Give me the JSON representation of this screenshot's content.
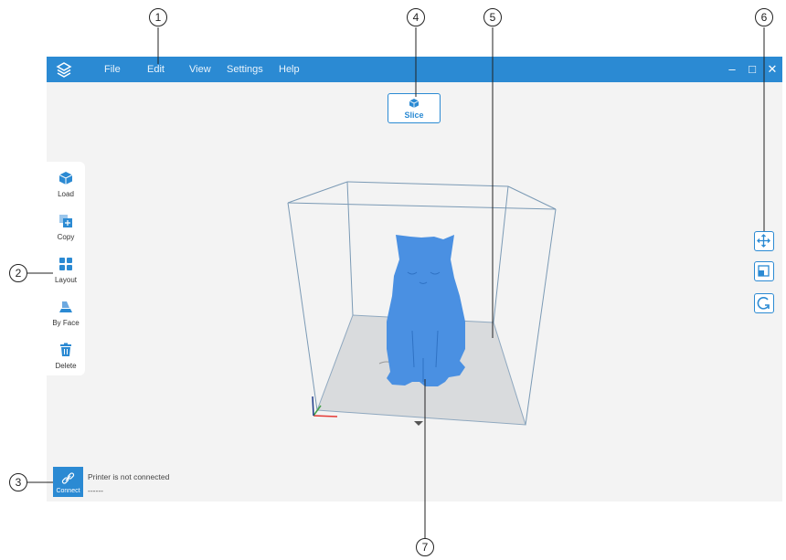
{
  "menu": {
    "file": "File",
    "edit": "Edit",
    "view": "View",
    "settings": "Settings",
    "help": "Help"
  },
  "window": {
    "minimize": "–",
    "maximize": "□",
    "close": "✕"
  },
  "slice": {
    "label": "Slice"
  },
  "toolbar": {
    "load": "Load",
    "copy": "Copy",
    "layout": "Layout",
    "by_face": "By Face",
    "delete": "Delete"
  },
  "connect": {
    "label": "Connect",
    "status": "Printer is not connected",
    "detail": "------"
  },
  "right_tools": {
    "move": "move-icon",
    "scale": "scale-icon",
    "rotate": "rotate-icon"
  },
  "callouts": {
    "c1": "1",
    "c2": "2",
    "c3": "3",
    "c4": "4",
    "c5": "5",
    "c6": "6",
    "c7": "7"
  },
  "colors": {
    "accent": "#2b8ad3",
    "model": "#4a90e2",
    "background": "#f3f3f3"
  }
}
